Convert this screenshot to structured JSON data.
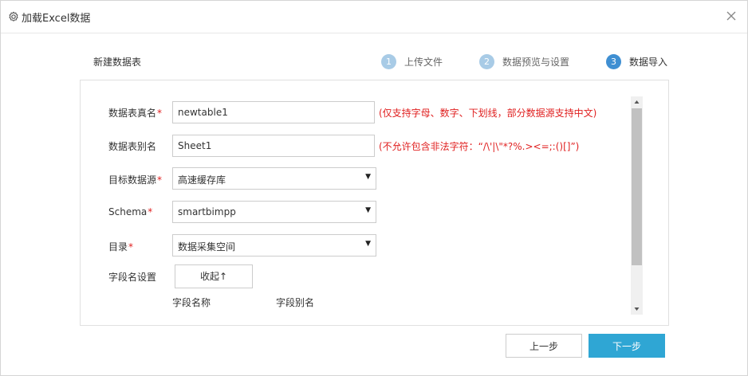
{
  "dialog": {
    "title": "加载Excel数据",
    "icon": "gear-icon",
    "close_icon": "close-icon"
  },
  "page_label": "新建数据表",
  "steps": [
    {
      "num": "1",
      "label": "上传文件",
      "active": false
    },
    {
      "num": "2",
      "label": "数据预览与设置",
      "active": false
    },
    {
      "num": "3",
      "label": "数据导入",
      "active": true
    }
  ],
  "form": {
    "table_name": {
      "label": "数据表真名",
      "required": "*",
      "value": "newtable1",
      "hint": "(仅支持字母、数字、下划线，部分数据源支持中文)"
    },
    "table_alias": {
      "label": "数据表别名",
      "value": "Sheet1",
      "hint": "(不允许包含非法字符：“/\\'|\\\"*?%.><=;:()[]”)"
    },
    "target_source": {
      "label": "目标数据源",
      "required": "*",
      "value": "高速缓存库"
    },
    "schema": {
      "label": "Schema",
      "required": "*",
      "value": "smartbimpp"
    },
    "catalog": {
      "label": "目录",
      "required": "*",
      "value": "数据采集空间"
    },
    "field_settings": {
      "label": "字段名设置",
      "collapse_button": "收起↑"
    },
    "columns": [
      "字段名称",
      "字段别名"
    ]
  },
  "buttons": {
    "prev": "上一步",
    "next": "下一步"
  },
  "colors": {
    "primary": "#2fa6d4",
    "step_active": "#3f8fd2",
    "step_inactive": "#a8cbe6",
    "error": "#e02020"
  }
}
